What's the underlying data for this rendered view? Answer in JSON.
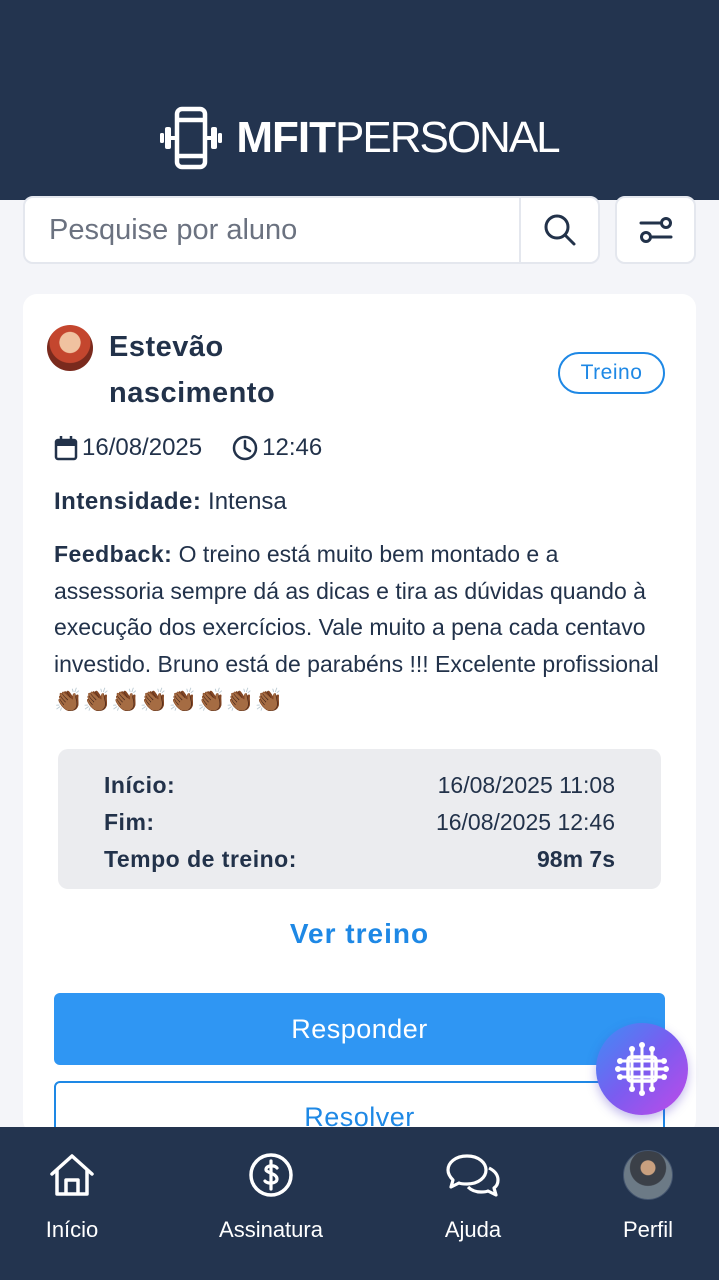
{
  "header": {
    "logo_bold": "MFIT",
    "logo_light": "PERSONAL",
    "logo_icon": "dumbbell-frame-icon"
  },
  "search": {
    "placeholder": "Pesquise por aluno",
    "value": "",
    "search_icon": "search-icon",
    "filter_icon": "sliders-filter-icon"
  },
  "card": {
    "student_name": "Estevão nascimento",
    "tag": "Treino",
    "date": "16/08/2025",
    "time": "12:46",
    "intensity_label": "Intensidade:",
    "intensity_value": "Intensa",
    "feedback_label": "Feedback:",
    "feedback_text": "O treino está muito bem montado e a assessoria sempre dá as dicas e tira as dúvidas quando à execução dos exercícios. Vale muito a pena cada centavo investido. Bruno está de parabéns !!! Excelente profissional",
    "feedback_emojis": "👏🏾👏🏾👏🏾👏🏾👏🏾👏🏾👏🏾👏🏾",
    "summary": {
      "start_label": "Início:",
      "start_value": "16/08/2025 11:08",
      "end_label": "Fim:",
      "end_value": "16/08/2025 12:46",
      "duration_label": "Tempo de treino:",
      "duration_value": "98m 7s"
    },
    "view_link": "Ver treino",
    "reply_button": "Responder",
    "resolve_button": "Resolver"
  },
  "bottom_nav": {
    "items": [
      {
        "label": "Início",
        "icon": "home-icon"
      },
      {
        "label": "Assinatura",
        "icon": "dollar-circle-icon"
      },
      {
        "label": "Ajuda",
        "icon": "chat-bubbles-icon"
      },
      {
        "label": "Perfil",
        "icon": "profile-avatar"
      }
    ]
  },
  "colors": {
    "header_bg": "#23344f",
    "accent": "#1e88e5",
    "primary_button": "#2f96f3"
  }
}
